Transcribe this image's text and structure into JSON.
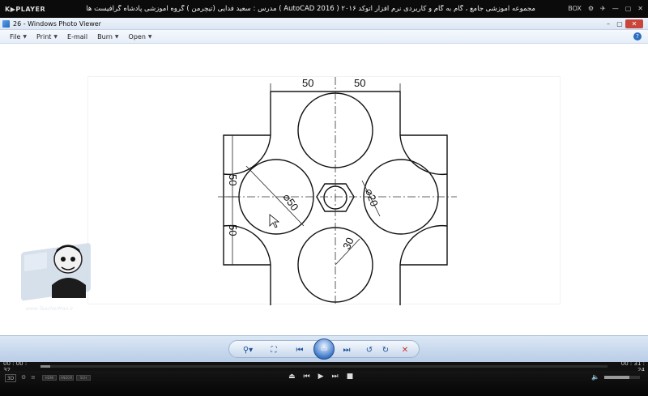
{
  "player": {
    "logo": "K▶PLAYER",
    "title": "مجموعه آموزشی جامع ، گام به گام و کاربردی نرم افزار   اتوکد ۲۰۱۶ ( AutoCAD  2016 )  مدرس : سعید فدایی (تیچرمن ) گروه آموزشی پادشاه گرافیست ها",
    "box_label": "BOX",
    "time_current": "00 : 00 : 32",
    "time_total": "00 : 31 : 24",
    "progress_percent": 1.7,
    "badge_3d": "3D",
    "mini_labels": [
      "HDMI",
      "ANDOR",
      "SCH"
    ]
  },
  "viewer": {
    "title": "26 - Windows Photo Viewer",
    "menu": [
      {
        "label": "File"
      },
      {
        "label": "Print"
      },
      {
        "label": "E-mail"
      },
      {
        "label": "Burn"
      },
      {
        "label": "Open"
      }
    ],
    "help_glyph": "?"
  },
  "drawing": {
    "dim_top_left": "50",
    "dim_top_right": "50",
    "dim_left_upper": "50",
    "dim_left_lower": "50",
    "dim_diameter": "⌀50",
    "dim_center": "⌀20",
    "dim_radius": "30"
  },
  "teacher": {
    "site": "www.TeacherMan.ir"
  },
  "colors": {
    "player_bg": "#0b0b0b",
    "viewer_bar": "#c8d8ec",
    "accent": "#3f79c9",
    "delete": "#c9302c"
  }
}
